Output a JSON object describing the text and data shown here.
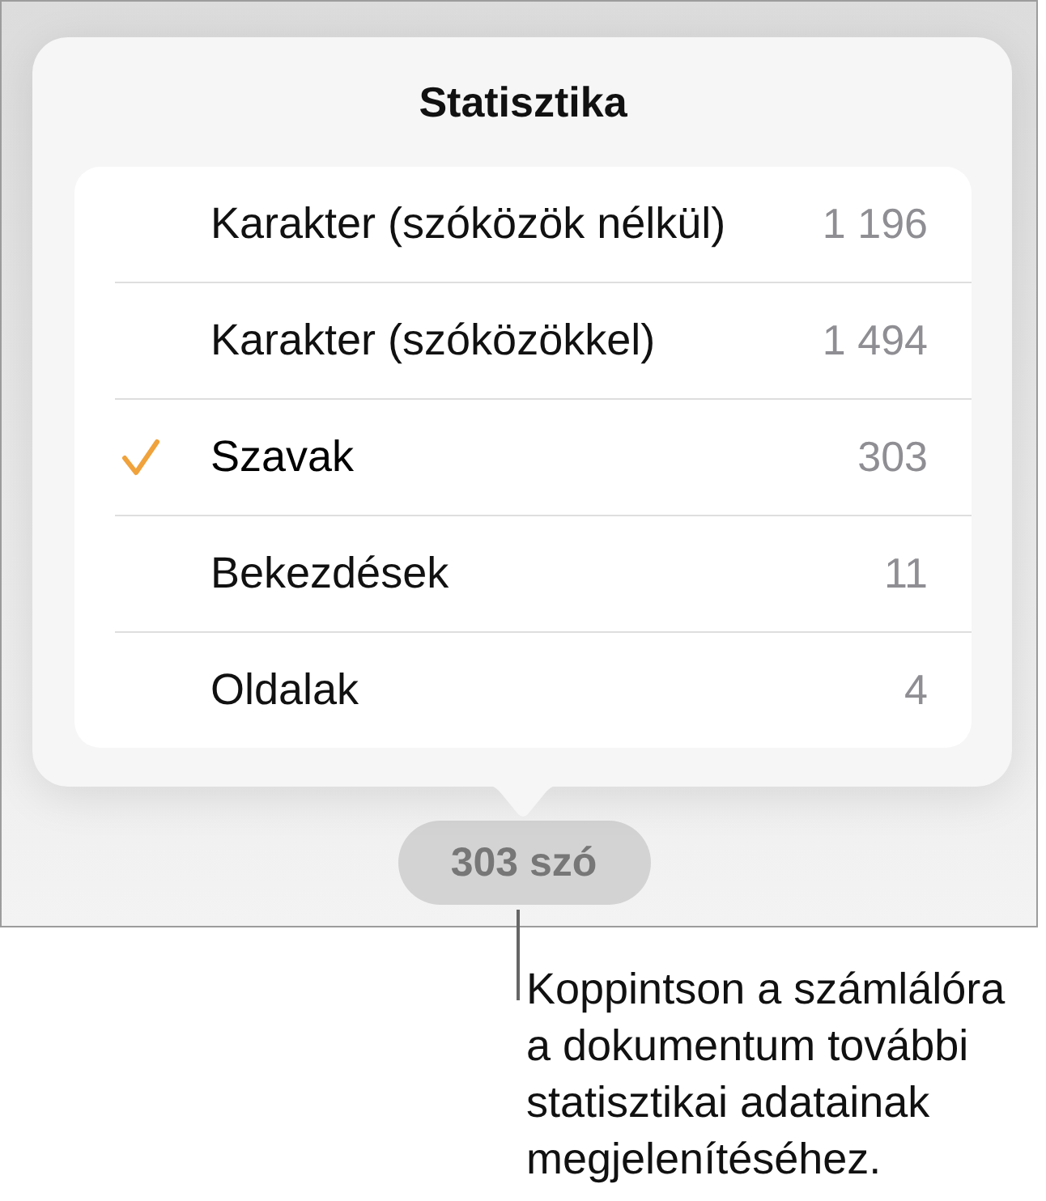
{
  "popover": {
    "title": "Statisztika",
    "rows": [
      {
        "label": "Karakter (szóközök nélkül)",
        "value": "1 196",
        "selected": false
      },
      {
        "label": "Karakter (szóközökkel)",
        "value": "1 494",
        "selected": false
      },
      {
        "label": "Szavak",
        "value": "303",
        "selected": true
      },
      {
        "label": "Bekezdések",
        "value": "11",
        "selected": false
      },
      {
        "label": "Oldalak",
        "value": "4",
        "selected": false
      }
    ]
  },
  "counter": {
    "label": "303 szó"
  },
  "callout": {
    "text": "Koppintson a számlálóra a dokumentum további statisztikai adatainak megjelenítéséhez."
  }
}
